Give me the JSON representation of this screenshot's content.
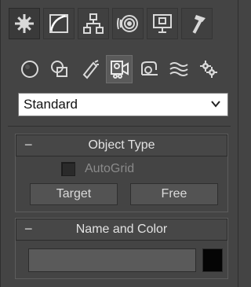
{
  "tabs": [
    {
      "name": "create",
      "icon": "create-icon",
      "active": true
    },
    {
      "name": "modify",
      "icon": "modify-icon",
      "active": false
    },
    {
      "name": "hierarchy",
      "icon": "hierarchy-icon",
      "active": false
    },
    {
      "name": "motion",
      "icon": "motion-icon",
      "active": false
    },
    {
      "name": "display",
      "icon": "display-icon",
      "active": false
    },
    {
      "name": "utilities",
      "icon": "utilities-icon",
      "active": false
    }
  ],
  "categories": [
    {
      "name": "geometry",
      "icon": "geometry-icon",
      "active": false
    },
    {
      "name": "shapes",
      "icon": "shapes-icon",
      "active": false
    },
    {
      "name": "lights",
      "icon": "lights-icon",
      "active": false
    },
    {
      "name": "cameras",
      "icon": "cameras-icon",
      "active": true
    },
    {
      "name": "helpers",
      "icon": "helpers-icon",
      "active": false
    },
    {
      "name": "space-warps",
      "icon": "space-warps-icon",
      "active": false
    },
    {
      "name": "systems",
      "icon": "systems-icon",
      "active": false
    }
  ],
  "dropdown": {
    "selected": "Standard"
  },
  "object_type": {
    "title": "Object Type",
    "collapse_symbol": "−",
    "autogrid_label": "AutoGrid",
    "autogrid_checked": false,
    "buttons": [
      "Target",
      "Free"
    ]
  },
  "name_and_color": {
    "title": "Name and Color",
    "collapse_symbol": "−",
    "name_value": "",
    "color": "#050505"
  }
}
